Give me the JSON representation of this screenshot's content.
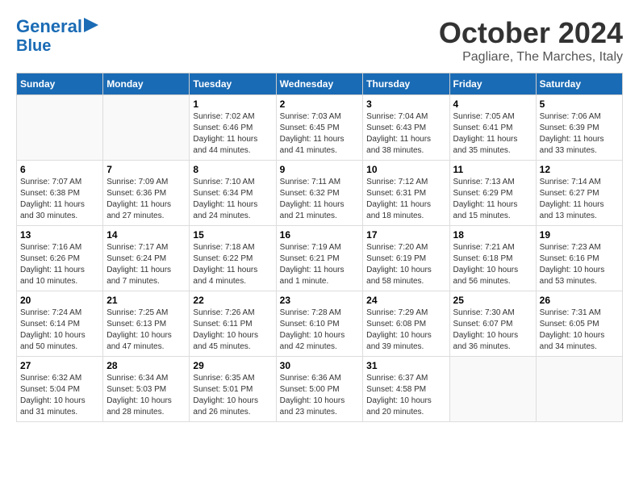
{
  "header": {
    "logo_line1": "General",
    "logo_line2": "Blue",
    "month": "October 2024",
    "location": "Pagliare, The Marches, Italy"
  },
  "days_of_week": [
    "Sunday",
    "Monday",
    "Tuesday",
    "Wednesday",
    "Thursday",
    "Friday",
    "Saturday"
  ],
  "weeks": [
    [
      {
        "day": "",
        "info": ""
      },
      {
        "day": "",
        "info": ""
      },
      {
        "day": "1",
        "info": "Sunrise: 7:02 AM\nSunset: 6:46 PM\nDaylight: 11 hours and 44 minutes."
      },
      {
        "day": "2",
        "info": "Sunrise: 7:03 AM\nSunset: 6:45 PM\nDaylight: 11 hours and 41 minutes."
      },
      {
        "day": "3",
        "info": "Sunrise: 7:04 AM\nSunset: 6:43 PM\nDaylight: 11 hours and 38 minutes."
      },
      {
        "day": "4",
        "info": "Sunrise: 7:05 AM\nSunset: 6:41 PM\nDaylight: 11 hours and 35 minutes."
      },
      {
        "day": "5",
        "info": "Sunrise: 7:06 AM\nSunset: 6:39 PM\nDaylight: 11 hours and 33 minutes."
      }
    ],
    [
      {
        "day": "6",
        "info": "Sunrise: 7:07 AM\nSunset: 6:38 PM\nDaylight: 11 hours and 30 minutes."
      },
      {
        "day": "7",
        "info": "Sunrise: 7:09 AM\nSunset: 6:36 PM\nDaylight: 11 hours and 27 minutes."
      },
      {
        "day": "8",
        "info": "Sunrise: 7:10 AM\nSunset: 6:34 PM\nDaylight: 11 hours and 24 minutes."
      },
      {
        "day": "9",
        "info": "Sunrise: 7:11 AM\nSunset: 6:32 PM\nDaylight: 11 hours and 21 minutes."
      },
      {
        "day": "10",
        "info": "Sunrise: 7:12 AM\nSunset: 6:31 PM\nDaylight: 11 hours and 18 minutes."
      },
      {
        "day": "11",
        "info": "Sunrise: 7:13 AM\nSunset: 6:29 PM\nDaylight: 11 hours and 15 minutes."
      },
      {
        "day": "12",
        "info": "Sunrise: 7:14 AM\nSunset: 6:27 PM\nDaylight: 11 hours and 13 minutes."
      }
    ],
    [
      {
        "day": "13",
        "info": "Sunrise: 7:16 AM\nSunset: 6:26 PM\nDaylight: 11 hours and 10 minutes."
      },
      {
        "day": "14",
        "info": "Sunrise: 7:17 AM\nSunset: 6:24 PM\nDaylight: 11 hours and 7 minutes."
      },
      {
        "day": "15",
        "info": "Sunrise: 7:18 AM\nSunset: 6:22 PM\nDaylight: 11 hours and 4 minutes."
      },
      {
        "day": "16",
        "info": "Sunrise: 7:19 AM\nSunset: 6:21 PM\nDaylight: 11 hours and 1 minute."
      },
      {
        "day": "17",
        "info": "Sunrise: 7:20 AM\nSunset: 6:19 PM\nDaylight: 10 hours and 58 minutes."
      },
      {
        "day": "18",
        "info": "Sunrise: 7:21 AM\nSunset: 6:18 PM\nDaylight: 10 hours and 56 minutes."
      },
      {
        "day": "19",
        "info": "Sunrise: 7:23 AM\nSunset: 6:16 PM\nDaylight: 10 hours and 53 minutes."
      }
    ],
    [
      {
        "day": "20",
        "info": "Sunrise: 7:24 AM\nSunset: 6:14 PM\nDaylight: 10 hours and 50 minutes."
      },
      {
        "day": "21",
        "info": "Sunrise: 7:25 AM\nSunset: 6:13 PM\nDaylight: 10 hours and 47 minutes."
      },
      {
        "day": "22",
        "info": "Sunrise: 7:26 AM\nSunset: 6:11 PM\nDaylight: 10 hours and 45 minutes."
      },
      {
        "day": "23",
        "info": "Sunrise: 7:28 AM\nSunset: 6:10 PM\nDaylight: 10 hours and 42 minutes."
      },
      {
        "day": "24",
        "info": "Sunrise: 7:29 AM\nSunset: 6:08 PM\nDaylight: 10 hours and 39 minutes."
      },
      {
        "day": "25",
        "info": "Sunrise: 7:30 AM\nSunset: 6:07 PM\nDaylight: 10 hours and 36 minutes."
      },
      {
        "day": "26",
        "info": "Sunrise: 7:31 AM\nSunset: 6:05 PM\nDaylight: 10 hours and 34 minutes."
      }
    ],
    [
      {
        "day": "27",
        "info": "Sunrise: 6:32 AM\nSunset: 5:04 PM\nDaylight: 10 hours and 31 minutes."
      },
      {
        "day": "28",
        "info": "Sunrise: 6:34 AM\nSunset: 5:03 PM\nDaylight: 10 hours and 28 minutes."
      },
      {
        "day": "29",
        "info": "Sunrise: 6:35 AM\nSunset: 5:01 PM\nDaylight: 10 hours and 26 minutes."
      },
      {
        "day": "30",
        "info": "Sunrise: 6:36 AM\nSunset: 5:00 PM\nDaylight: 10 hours and 23 minutes."
      },
      {
        "day": "31",
        "info": "Sunrise: 6:37 AM\nSunset: 4:58 PM\nDaylight: 10 hours and 20 minutes."
      },
      {
        "day": "",
        "info": ""
      },
      {
        "day": "",
        "info": ""
      }
    ]
  ]
}
